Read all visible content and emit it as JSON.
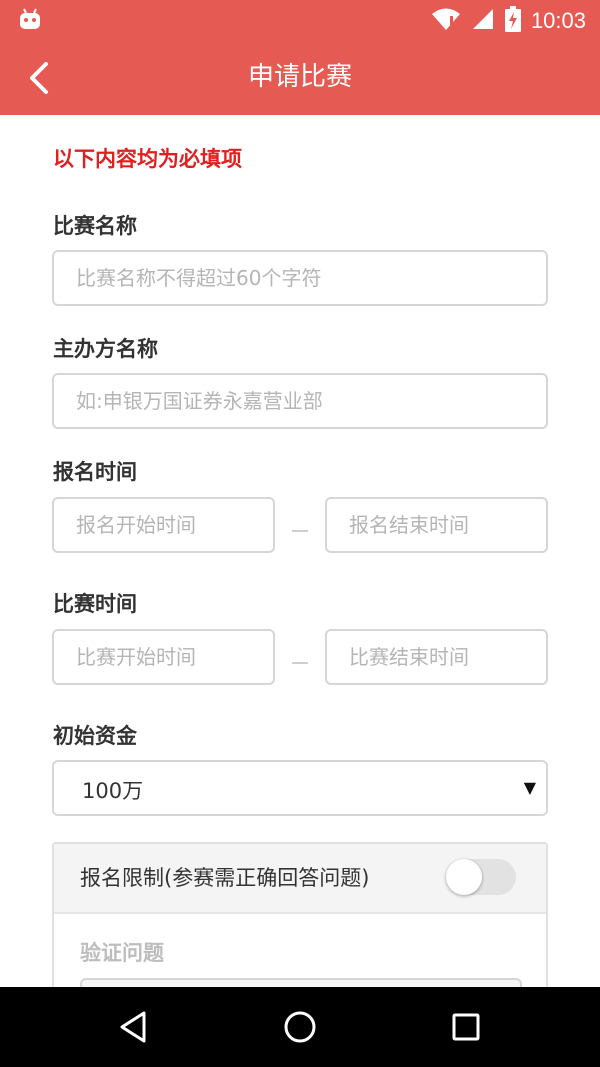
{
  "status_bar": {
    "time": "10:03",
    "icons": [
      "android-debug-icon",
      "wifi-icon",
      "signal-icon",
      "battery-charging-icon"
    ]
  },
  "app_bar": {
    "title": "申请比赛",
    "back_icon": "chevron-left-icon"
  },
  "form": {
    "required_note": "以下内容均为必填项",
    "contest_name": {
      "label": "比赛名称",
      "placeholder": "比赛名称不得超过60个字符"
    },
    "organizer": {
      "label": "主办方名称",
      "placeholder": "如:申银万国证券永嘉营业部"
    },
    "signup_time": {
      "label": "报名时间",
      "start_placeholder": "报名开始时间",
      "end_placeholder": "报名结束时间",
      "separator": "—"
    },
    "contest_time": {
      "label": "比赛时间",
      "start_placeholder": "比赛开始时间",
      "end_placeholder": "比赛结束时间",
      "separator": "—"
    },
    "initial_fund": {
      "label": "初始资金",
      "selected": "100万",
      "arrow": "▼"
    },
    "signup_limit": {
      "title": "报名限制(参赛需正确回答问题)",
      "enabled": false,
      "verify_label": "验证问题"
    }
  },
  "nav_bar": {
    "icons": [
      "back-triangle-icon",
      "home-circle-icon",
      "recents-square-icon"
    ]
  },
  "colors": {
    "accent": "#e55a52",
    "required_text": "#e02020"
  }
}
